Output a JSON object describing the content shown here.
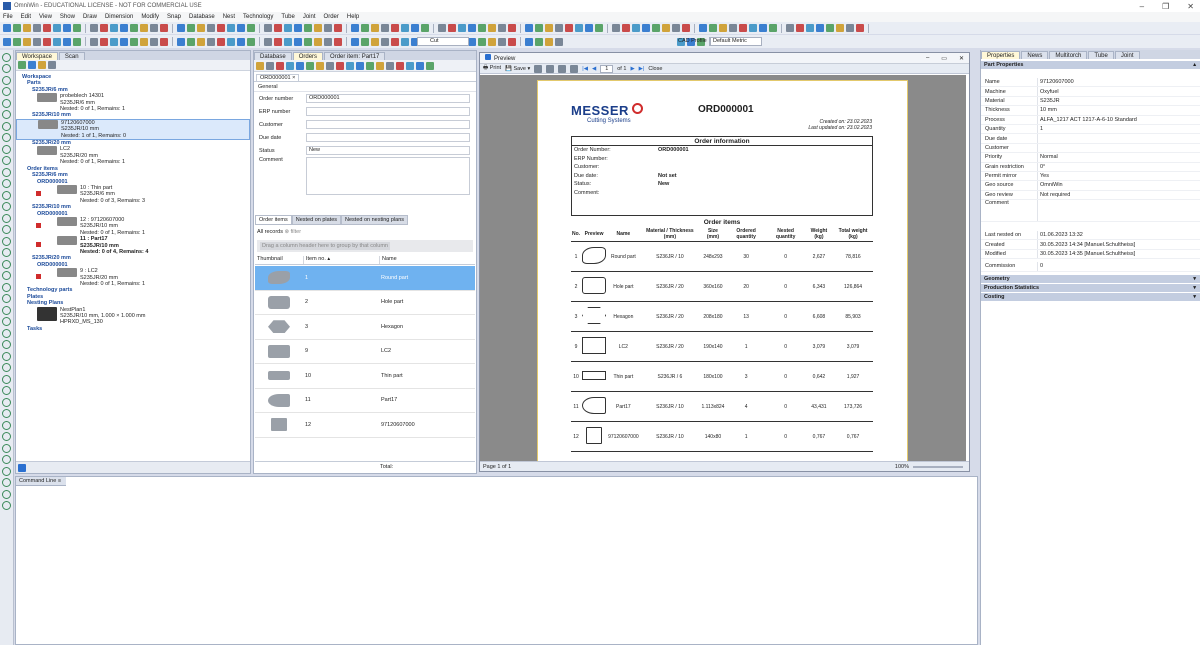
{
  "app": {
    "title": "OmniWin - EDUCATIONAL LICENSE - NOT FOR COMMERCIAL USE"
  },
  "menu": [
    "File",
    "Edit",
    "View",
    "Show",
    "Draw",
    "Dimension",
    "Modify",
    "Snap",
    "Database",
    "Nest",
    "Technology",
    "Tube",
    "Joint",
    "Order",
    "Help"
  ],
  "toolbar": {
    "cut_value": "Cut",
    "cad_profile_label": "CAD Profile",
    "cad_profile_value": "Default Metric"
  },
  "workspace": {
    "tabs": [
      "Workspace",
      "Scan"
    ],
    "items": [
      {
        "t": "Workspace",
        "h": true,
        "i": 0
      },
      {
        "t": "Parts",
        "h": true,
        "i": 1
      },
      {
        "t": "S235JR/6 mm",
        "h": true,
        "i": 2
      },
      {
        "t": "probeblech 14301",
        "s": "S235JR/6 mm",
        "n": "Nested: 0 of 1, Remains: 1",
        "i": 3
      },
      {
        "t": "S235JR/10 mm",
        "h": true,
        "i": 2
      },
      {
        "t": "97120607000",
        "s": "S235JR/10 mm",
        "n": "Nested: 1 of 1, Remains: 0",
        "i": 3,
        "sel": true
      },
      {
        "t": "S235JR/20 mm",
        "h": true,
        "i": 2
      },
      {
        "t": "LC2",
        "s": "S235JR/20 mm",
        "n": "Nested: 0 of 1, Remains: 1",
        "i": 3
      },
      {
        "t": "Order items",
        "h": true,
        "i": 1
      },
      {
        "t": "S235JR/6 mm",
        "h": true,
        "i": 2
      },
      {
        "t": "ORD000001",
        "h": true,
        "i": 3
      },
      {
        "t": "10 : Thin part",
        "s": "S235JR/6 mm",
        "n": "Nested: 0 of 3, Remains: 3",
        "i": 4,
        "red": true
      },
      {
        "t": "S235JR/10 mm",
        "h": true,
        "i": 2
      },
      {
        "t": "ORD000001",
        "h": true,
        "i": 3
      },
      {
        "t": "12 : 97120607000",
        "s": "S235JR/10 mm",
        "n": "Nested: 0 of 1, Remains: 1",
        "i": 4,
        "red": true
      },
      {
        "t": "11 : Part17",
        "s": "S235JR/10 mm",
        "n": "Nested: 0 of 4, Remains: 4",
        "i": 4,
        "red": true,
        "b": true
      },
      {
        "t": "S235JR/20 mm",
        "h": true,
        "i": 2
      },
      {
        "t": "ORD000001",
        "h": true,
        "i": 3
      },
      {
        "t": "9 : LC2",
        "s": "S235JR/20 mm",
        "n": "Nested: 0 of 1, Remains: 1",
        "i": 4,
        "red": true
      },
      {
        "t": "Technology parts",
        "h": true,
        "i": 1
      },
      {
        "t": "Plates",
        "h": true,
        "i": 1
      },
      {
        "t": "Nesting Plans",
        "h": true,
        "i": 1
      },
      {
        "t": "NestPlan1",
        "s": "S235JR/10 mm, 1.000 × 1.000 mm",
        "n": "HPRXD_MS_130",
        "i": 3,
        "dark": true
      },
      {
        "t": "Tasks",
        "h": true,
        "i": 1
      }
    ]
  },
  "orders": {
    "tabs": [
      "Database",
      "Orders",
      "Order item: Part17"
    ],
    "doc_tab": "ORD000001",
    "general": "General",
    "fields": [
      {
        "label": "Order number",
        "value": "ORD000001"
      },
      {
        "label": "ERP number",
        "value": ""
      },
      {
        "label": "Customer",
        "value": ""
      },
      {
        "label": "Due date",
        "value": ""
      },
      {
        "label": "Status",
        "value": "New"
      },
      {
        "label": "Comment",
        "value": ""
      }
    ],
    "subtabs": [
      "Order items",
      "Nested on plates",
      "Nested on nesting plans"
    ],
    "all_records": "All records",
    "filter": "filter",
    "group_hint": "Drag a column header here to group by that column",
    "columns": [
      "Thumbnail",
      "Item no.",
      "Name"
    ],
    "rows": [
      {
        "no": "1",
        "name": "Round part"
      },
      {
        "no": "2",
        "name": "Hole part"
      },
      {
        "no": "3",
        "name": "Hexagon"
      },
      {
        "no": "9",
        "name": "LC2"
      },
      {
        "no": "10",
        "name": "Thin part"
      },
      {
        "no": "11",
        "name": "Part17"
      },
      {
        "no": "12",
        "name": "97120607000"
      }
    ],
    "total": "Total:"
  },
  "preview": {
    "title": "Preview",
    "print": "Print",
    "save": "Save",
    "page_num": "1",
    "page_of": "of 1",
    "close": "Close",
    "page_status": "Page 1 of 1",
    "zoom": "100%",
    "doc": {
      "logo": "MESSER",
      "logo_sub": "Cutting Systems",
      "order_id": "ORD000001",
      "created": "Created on: 23.02.2023",
      "updated": "Last updated on: 23.02.2023",
      "info_title": "Order information",
      "info": [
        {
          "k": "Order Number:",
          "v": "ORD000001"
        },
        {
          "k": "ERP Number:",
          "v": ""
        },
        {
          "k": "Customer:",
          "v": ""
        },
        {
          "k": "Due date:",
          "v": "Not set"
        },
        {
          "k": "Status:",
          "v": "New"
        },
        {
          "k": "Comment:",
          "v": ""
        }
      ],
      "items_title": "Order items",
      "headers": [
        "No.",
        "Preview",
        "Name",
        "Material / Thickness (mm)",
        "Size (mm)",
        "Ordered quantity",
        "Nested quantity",
        "Weight (kg)",
        "Total weight (kg)"
      ],
      "items": [
        {
          "no": "1",
          "name": "Round part",
          "mat": "S236JR / 10",
          "size": "248x293",
          "oq": "30",
          "nq": "0",
          "w": "2,627",
          "tw": "78,816"
        },
        {
          "no": "2",
          "name": "Hole part",
          "mat": "S236JR / 20",
          "size": "360x160",
          "oq": "20",
          "nq": "0",
          "w": "6,343",
          "tw": "126,864"
        },
        {
          "no": "3",
          "name": "Hexagon",
          "mat": "S236JR / 20",
          "size": "208x180",
          "oq": "13",
          "nq": "0",
          "w": "6,608",
          "tw": "85,903"
        },
        {
          "no": "9",
          "name": "LC2",
          "mat": "S236JR / 20",
          "size": "190x140",
          "oq": "1",
          "nq": "0",
          "w": "3,079",
          "tw": "3,079"
        },
        {
          "no": "10",
          "name": "Thin part",
          "mat": "S236JR / 6",
          "size": "180x100",
          "oq": "3",
          "nq": "0",
          "w": "0,642",
          "tw": "1,927"
        },
        {
          "no": "11",
          "name": "Part17",
          "mat": "S236JR / 10",
          "size": "1.113x824",
          "oq": "4",
          "nq": "0",
          "w": "43,431",
          "tw": "173,726"
        },
        {
          "no": "12",
          "name": "97120607000",
          "mat": "S236JR / 10",
          "size": "140x80",
          "oq": "1",
          "nq": "0",
          "w": "0,767",
          "tw": "0,767"
        }
      ]
    }
  },
  "props": {
    "tabs": [
      "Properties",
      "News",
      "Multitorch",
      "Tube",
      "Joint"
    ],
    "section": "Part Properties",
    "rows": [
      {
        "k": "Name",
        "v": "97120607000"
      },
      {
        "k": "Machine",
        "v": "Oxyfuel"
      },
      {
        "k": "Material",
        "v": "S235JR"
      },
      {
        "k": "Thickness",
        "v": "10 mm"
      },
      {
        "k": "Process",
        "v": "ALFA_1217 ACT 1217-A-6-10 Standard"
      },
      {
        "k": "Quantity",
        "v": "1"
      },
      {
        "k": "Due date",
        "v": ""
      },
      {
        "k": "Customer",
        "v": ""
      },
      {
        "k": "Priority",
        "v": "Normal"
      },
      {
        "k": "Grain restriction",
        "v": "0°"
      },
      {
        "k": "Permit mirror",
        "v": "Yes"
      },
      {
        "k": "Geo source",
        "v": "OmniWin"
      },
      {
        "k": "Geo review",
        "v": "Not required"
      },
      {
        "k": "Comment",
        "v": ""
      }
    ],
    "meta": [
      {
        "k": "Last nested on",
        "v": "01.06.2023 13:32"
      },
      {
        "k": "Created",
        "v": "30.05.2023 14:34 [Manuel.Schultheiss]"
      },
      {
        "k": "Modified",
        "v": "30.05.2023 14:35 [Manuel.Schultheiss]"
      }
    ],
    "commission": {
      "k": "Commission",
      "v": "0"
    },
    "sections": [
      "Geometry",
      "Production Statistics",
      "Costing"
    ]
  },
  "cmd": {
    "title": "Command Line"
  }
}
